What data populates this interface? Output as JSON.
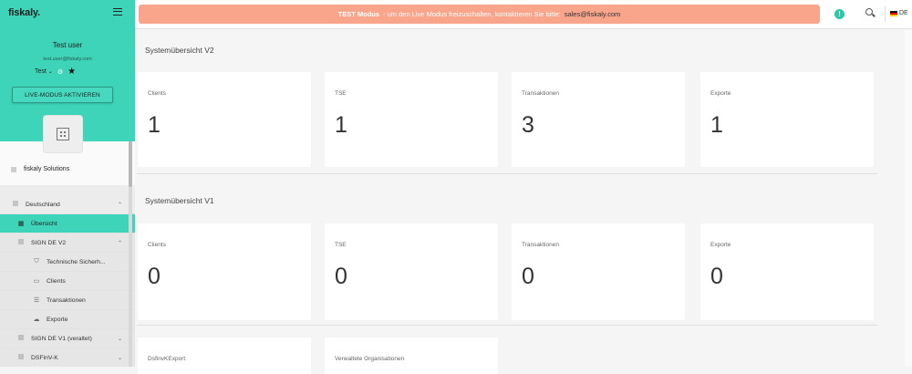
{
  "sidebar": {
    "logo": "fiskaly.",
    "user_name": "Test user",
    "email": "test.user@fiskaly.com",
    "env_label": "Test",
    "live_button": "LIVE-MODUS AKTIVIEREN",
    "org_name": "fiskaly Solutions",
    "nav": {
      "deutschland": "Deutschland",
      "uebersicht": "Übersicht",
      "sign_de_v2": "SIGN DE V2",
      "tech": "Technische Sicherh...",
      "clients": "Clients",
      "transaktionen": "Transaktionen",
      "exporte": "Exporte",
      "sign_de_v1": "SIGN DE V1 (veraltet)",
      "dsfinvk": "DSFinV-K"
    }
  },
  "topbar": {
    "banner_bold": "TEST Modus",
    "banner_text": " - um den Live Modus freizuschalten, kontaktieren Sie bitte: ",
    "banner_mail": "sales@fiskaly.com",
    "lang": "DE"
  },
  "main": {
    "v2_title": "Systemübersicht V2",
    "v2_cards": [
      {
        "label": "Clients",
        "value": "1"
      },
      {
        "label": "TSE",
        "value": "1"
      },
      {
        "label": "Transaktionen",
        "value": "3"
      },
      {
        "label": "Exporte",
        "value": "1"
      }
    ],
    "v1_title": "Systemübersicht V1",
    "v1_cards": [
      {
        "label": "Clients",
        "value": "0"
      },
      {
        "label": "TSE",
        "value": "0"
      },
      {
        "label": "Transaktionen",
        "value": "0"
      },
      {
        "label": "Exporte",
        "value": "0"
      }
    ],
    "extra_cards": [
      {
        "label": "DsfinvKExport"
      },
      {
        "label": "Verwaltete Organisationen"
      }
    ]
  },
  "colors": {
    "accent": "#3ed4b9",
    "banner": "#f8a58c"
  }
}
